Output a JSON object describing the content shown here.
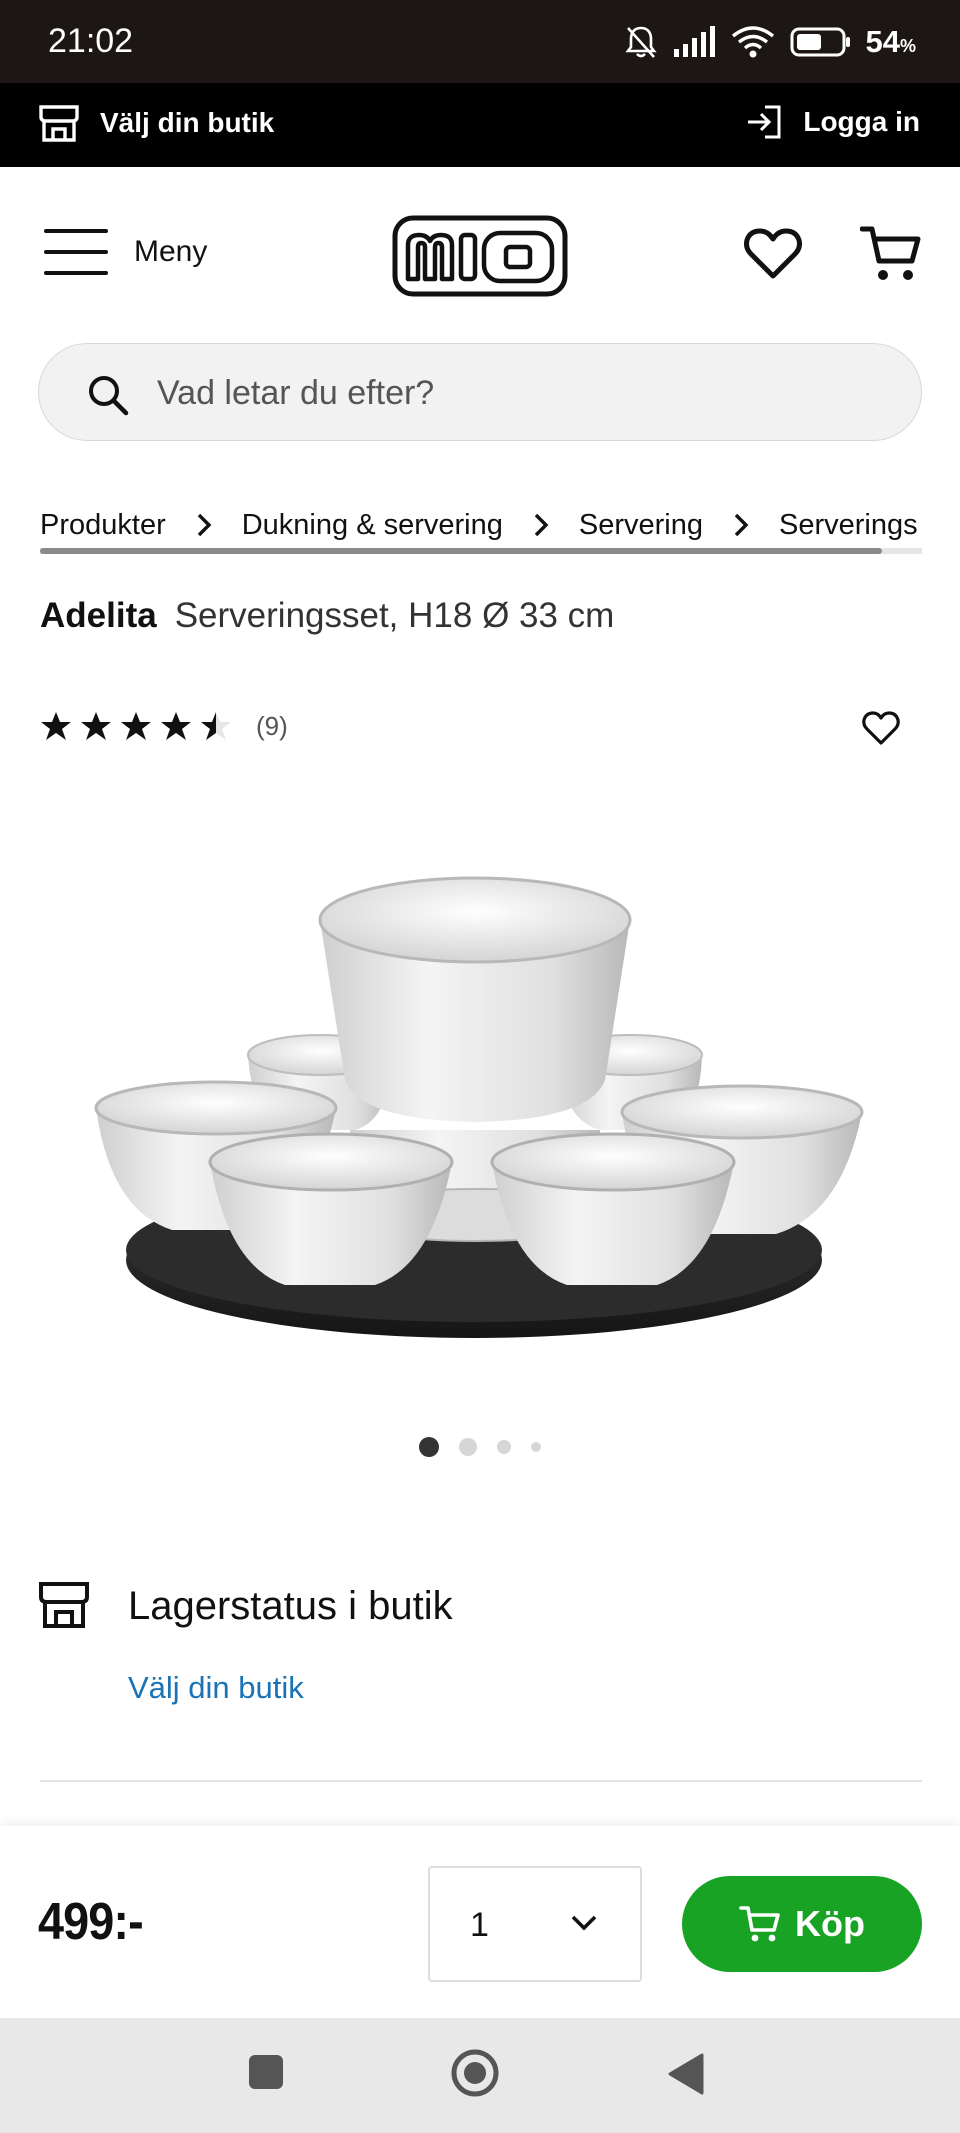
{
  "status_bar": {
    "time": "21:02",
    "battery": "54",
    "battery_unit": "%"
  },
  "store_bar": {
    "choose_store": "Välj din butik",
    "login": "Logga in"
  },
  "header": {
    "menu_label": "Meny",
    "logo_text": "MIO"
  },
  "search": {
    "placeholder": "Vad letar du efter?"
  },
  "breadcrumb": {
    "items": [
      "Produkter",
      "Dukning & servering",
      "Servering",
      "Serverings"
    ]
  },
  "product": {
    "brand": "Adelita",
    "description": "Serveringsset, H18 Ø 33 cm",
    "rating": 4.5,
    "review_count": "(9)",
    "image_count": 4,
    "active_image": 1
  },
  "stock": {
    "title": "Lagerstatus i butik",
    "choose_store_link": "Välj din butik"
  },
  "buy_bar": {
    "price": "499:-",
    "quantity": "1",
    "buy_label": "Köp"
  },
  "colors": {
    "buy_green": "#19a324",
    "link_blue": "#1a73b5",
    "top_bar": "#000000",
    "status_bar": "#1c1715"
  }
}
